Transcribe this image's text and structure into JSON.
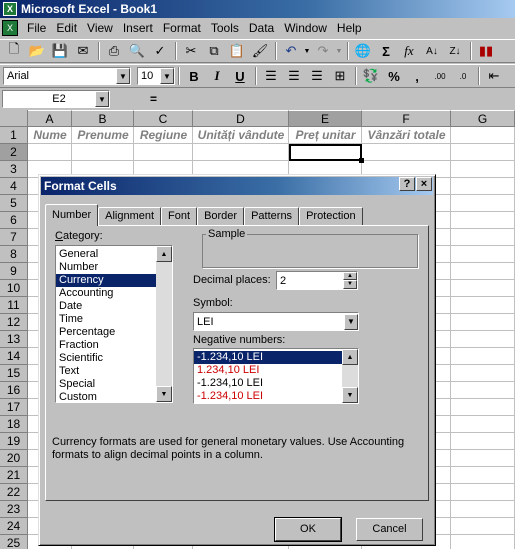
{
  "window": {
    "title": "Microsoft Excel - Book1"
  },
  "menu": [
    "File",
    "Edit",
    "View",
    "Insert",
    "Format",
    "Tools",
    "Data",
    "Window",
    "Help"
  ],
  "toolbar": {
    "font_name": "Arial",
    "font_size": "10"
  },
  "formula_bar": {
    "name_box": "E2",
    "equals": "="
  },
  "grid": {
    "columns": [
      "A",
      "B",
      "C",
      "D",
      "E",
      "F",
      "G"
    ],
    "rows": [
      "1",
      "2",
      "3",
      "4",
      "5",
      "6",
      "7",
      "8",
      "9",
      "10",
      "11",
      "12",
      "13",
      "14",
      "15",
      "16",
      "17",
      "18",
      "19",
      "20",
      "21",
      "22",
      "23",
      "24",
      "25"
    ],
    "header_row": [
      "Nume",
      "Prenume",
      "Regiune",
      "Unități vândute",
      "Preț unitar",
      "Vânzări totale"
    ],
    "active_cell": "E2"
  },
  "dialog": {
    "title": "Format Cells",
    "help_button": "?",
    "close_button": "×",
    "tabs": [
      "Number",
      "Alignment",
      "Font",
      "Border",
      "Patterns",
      "Protection"
    ],
    "active_tab": "Number",
    "category_label": "Category:",
    "categories": [
      "General",
      "Number",
      "Currency",
      "Accounting",
      "Date",
      "Time",
      "Percentage",
      "Fraction",
      "Scientific",
      "Text",
      "Special",
      "Custom"
    ],
    "selected_category": "Currency",
    "sample_label": "Sample",
    "decimal_label": "Decimal places:",
    "decimal_value": "2",
    "symbol_label": "Symbol:",
    "symbol_value": "LEI",
    "negative_label": "Negative numbers:",
    "negative_numbers": [
      {
        "text": "-1.234,10 LEI",
        "color": "#000000",
        "selected": true
      },
      {
        "text": "1.234,10 LEI",
        "color": "#cc0000",
        "selected": false
      },
      {
        "text": "-1.234,10 LEI",
        "color": "#000000",
        "selected": false
      },
      {
        "text": "-1.234,10 LEI",
        "color": "#cc0000",
        "selected": false
      }
    ],
    "description": "Currency formats are used for general monetary values.  Use Accounting formats to align decimal points in a column.",
    "ok_label": "OK",
    "cancel_label": "Cancel"
  },
  "colors": {
    "title_bar": "#0a246a",
    "selection": "#0a246a",
    "negative_red": "#cc0000",
    "face": "#c0c0c0"
  }
}
